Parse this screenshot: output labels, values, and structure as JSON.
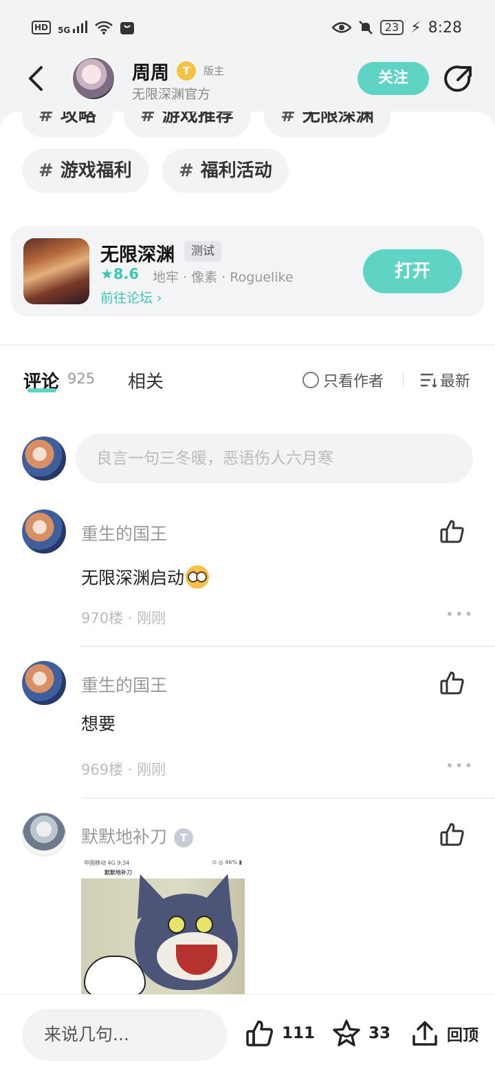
{
  "status_bar": {
    "left_icons": [
      "hd-icon",
      "5g-signal-icon",
      "wifi-icon",
      "bag-notification-icon"
    ],
    "hd_label": "HD",
    "net_label": "5G",
    "battery": "23",
    "time": "8:28"
  },
  "header": {
    "author_name": "周周",
    "badge_letter": "T",
    "role": "版主",
    "subtitle": "无限深渊官方",
    "follow_label": "关注"
  },
  "tags": {
    "hash": "#",
    "row1": [
      "攻略",
      "游戏推荐",
      "无限深渊"
    ],
    "row2": [
      "游戏福利",
      "福利活动"
    ]
  },
  "game_card": {
    "title": "无限深渊",
    "chip": "测试",
    "rating": "★8.6",
    "tags": "地牢 · 像素 · Roguelike",
    "forum_link": "前往论坛 ›",
    "open_label": "打开"
  },
  "tabs": {
    "comments_label": "评论",
    "comments_count": "925",
    "related_label": "相关",
    "only_author_label": "只看作者",
    "sort_label": "最新"
  },
  "comment_input": {
    "placeholder": "良言一句三冬暖，恶语伤人六月寒"
  },
  "comments": [
    {
      "user": "重生的国王",
      "text": "无限深渊启动",
      "floor": "970楼 · 刚刚"
    },
    {
      "user": "重生的国王",
      "text": "想要",
      "floor": "969楼 · 刚刚"
    },
    {
      "user": "默默地补刀",
      "badge_letter": "T",
      "text": ""
    }
  ],
  "embedded_screenshot": {
    "top_left": "中国移动  4G  9:34",
    "top_right": "⊙ ◎ 46% ▮",
    "title": "默默地补刀"
  },
  "bottom_bar": {
    "input_placeholder": "来说几句...",
    "likes": "111",
    "favorites": "33",
    "top_label": "回顶"
  },
  "colors": {
    "accent": "#5fd4c4",
    "accent_text": "#3ec6b3",
    "background": "#f2f3f5"
  }
}
